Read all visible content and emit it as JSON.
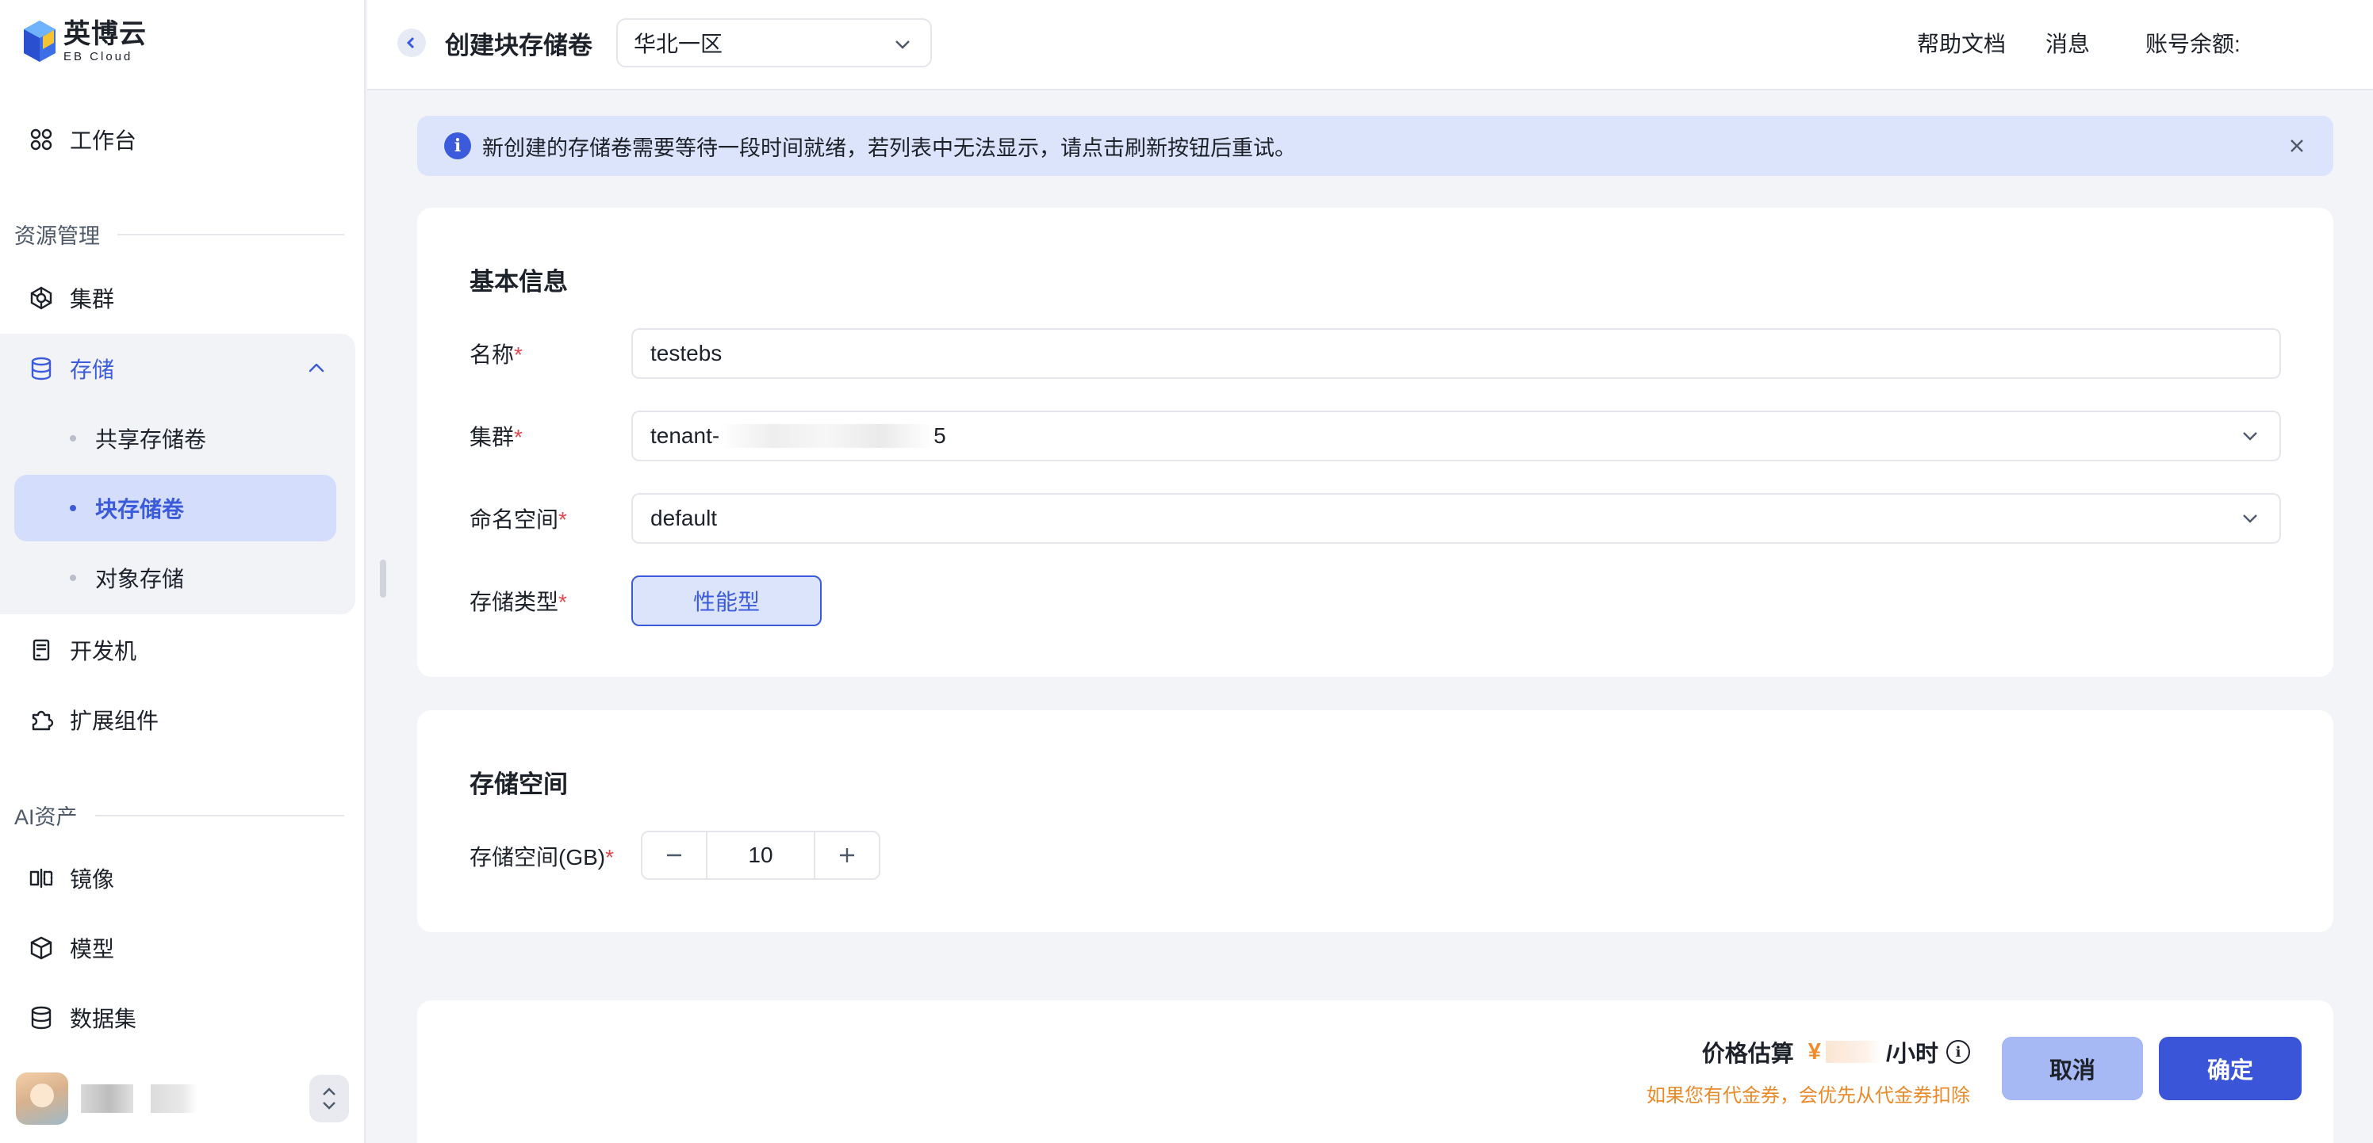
{
  "brand": {
    "name_cn": "英博云",
    "name_en": "EB Cloud"
  },
  "sidebar": {
    "workspace": "工作台",
    "sections": {
      "resources": "资源管理",
      "ai_assets": "AI资产"
    },
    "cluster": "集群",
    "storage": {
      "label": "存储",
      "children": [
        "共享存储卷",
        "块存储卷",
        "对象存储"
      ],
      "active_child": "块存储卷"
    },
    "devbox": "开发机",
    "extensions": "扩展组件",
    "image": "镜像",
    "model": "模型",
    "dataset": "数据集"
  },
  "header": {
    "title": "创建块存储卷",
    "region": "华北一区",
    "links": {
      "help": "帮助文档",
      "messages": "消息",
      "balance": "账号余额:"
    }
  },
  "alert": {
    "text": "新创建的存储卷需要等待一段时间就绪，若列表中无法显示，请点击刷新按钮后重试。"
  },
  "basic_info": {
    "title": "基本信息",
    "name": {
      "label": "名称",
      "value": "testebs"
    },
    "cluster": {
      "label": "集群",
      "value_prefix": "tenant-",
      "value_suffix": "5"
    },
    "namespace": {
      "label": "命名空间",
      "value": "default"
    },
    "storage_type": {
      "label": "存储类型",
      "selected": "性能型"
    }
  },
  "storage_space": {
    "title": "存储空间",
    "size": {
      "label": "存储空间(GB)",
      "value": "10"
    }
  },
  "footer": {
    "price_label": "价格估算",
    "currency": "¥",
    "unit": "/小时",
    "note": "如果您有代金券，会优先从代金券扣除",
    "cancel": "取消",
    "confirm": "确定"
  },
  "colors": {
    "accent": "#3c5bdc",
    "warning_text": "#e88a2a",
    "required": "#e5484d"
  }
}
